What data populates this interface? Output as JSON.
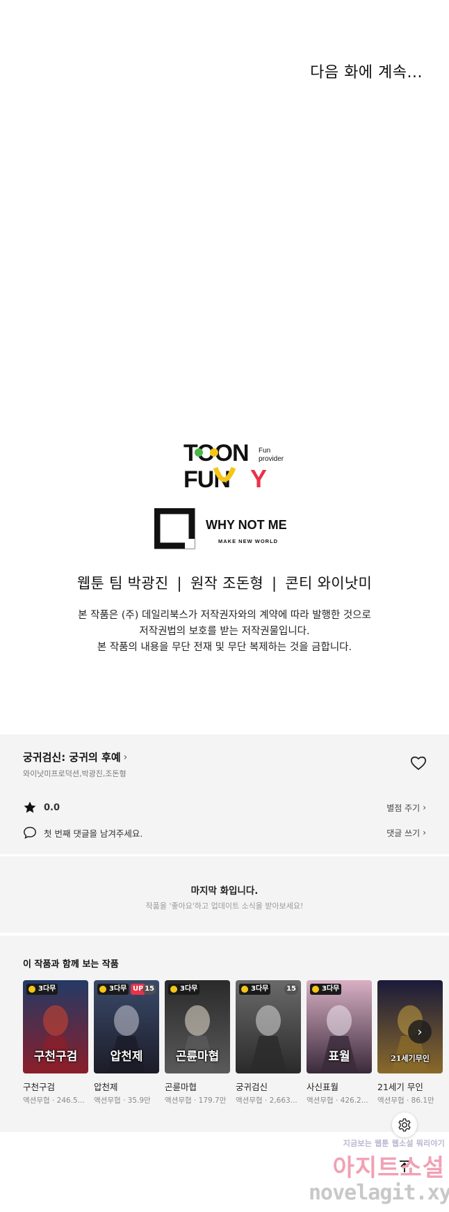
{
  "panel": {
    "to_be_continued": "다음 화에 계속...",
    "logo_toonfunny": {
      "line1": "TOON",
      "line2": "FUN",
      "line2b": "Y",
      "tag1": "Fun",
      "tag2": "provider"
    },
    "logo_wnm": {
      "name": "WHY NOT ME",
      "tagline": "MAKE NEW WORLD"
    },
    "credits": [
      "웹툰 팀 박광진",
      "원작 조돈형",
      "콘티 와이낫미"
    ],
    "credits_separator": "|",
    "notice": [
      "본 작품은 (주) 데일리북스가 저작권자와의 계약에 따라 발행한 것으로",
      "저작권법의 보호를 받는 저작권물입니다.",
      "본 작품의 내용을 무단 전재 및 무단 복제하는 것을 금합니다."
    ]
  },
  "info": {
    "title": "궁귀검신: 궁귀의 후예",
    "authors": "와이낫미프로덕션,박광진,조돈형",
    "rating": "0.0",
    "rate_link": "별점 주기",
    "comment_placeholder": "첫 번째 댓글을 남겨주세요.",
    "comment_link": "댓글 쓰기"
  },
  "last_episode": {
    "title": "마지막 화입니다.",
    "subtitle": "작품을 '좋아요'하고 업데이트 소식을 받아보세요!"
  },
  "recommendations": {
    "heading": "이 작품과 함께 보는 작품",
    "items": [
      {
        "title": "구천구검",
        "meta": "액션무협 · 246.5...",
        "badge": "3다무",
        "up": "",
        "num": "",
        "thumb_text": "구천구검",
        "colors": [
          "#233a66",
          "#8a1f2a",
          "#d4452e"
        ]
      },
      {
        "title": "압천제",
        "meta": "액션무협 · 35.9만",
        "badge": "3다무",
        "up": "UP",
        "num": "15",
        "thumb_text": "압천제",
        "colors": [
          "#3a4a6a",
          "#1c1c28",
          "#c9c9d6"
        ]
      },
      {
        "title": "곤륜마협",
        "meta": "액션무협 · 179.7만",
        "badge": "3다무",
        "up": "",
        "num": "",
        "thumb_text": "곤륜마협",
        "colors": [
          "#2a2a2a",
          "#5a5a5a",
          "#e8e0d0"
        ]
      },
      {
        "title": "궁귀검신",
        "meta": "액션무협 · 2,663...",
        "badge": "3다무",
        "up": "",
        "num": "15",
        "thumb_text": "",
        "colors": [
          "#6a6a6a",
          "#2a2a2a",
          "#d8d8d8"
        ]
      },
      {
        "title": "사신표월",
        "meta": "액션무협 · 426.2...",
        "badge": "3다무",
        "up": "",
        "num": "",
        "thumb_text": "표월",
        "colors": [
          "#d8b0c4",
          "#3a2a3a",
          "#f0e8f0"
        ]
      },
      {
        "title": "21세기 무인",
        "meta": "액션무협 · 86.1만",
        "badge": "",
        "up": "",
        "num": "",
        "thumb_text": "21세기무인",
        "colors": [
          "#1a1a3a",
          "#8a6a2a",
          "#c4a040"
        ]
      }
    ]
  },
  "watermark": {
    "line1": "지금보는 웹툰 웹소설 뭐리야기",
    "line2": "아지트소설",
    "line3": "novelagit.xyz"
  },
  "icons": {
    "heart": "heart-icon",
    "star": "star-icon",
    "comment": "comment-icon",
    "chevron": "chevron-right-icon",
    "settings": "gear-icon",
    "scroll_top": "arrow-up-icon"
  },
  "colors": {
    "section_bg": "#f4f4f4",
    "up_badge": "#e8334a",
    "wait_badge": "#f5c518"
  }
}
